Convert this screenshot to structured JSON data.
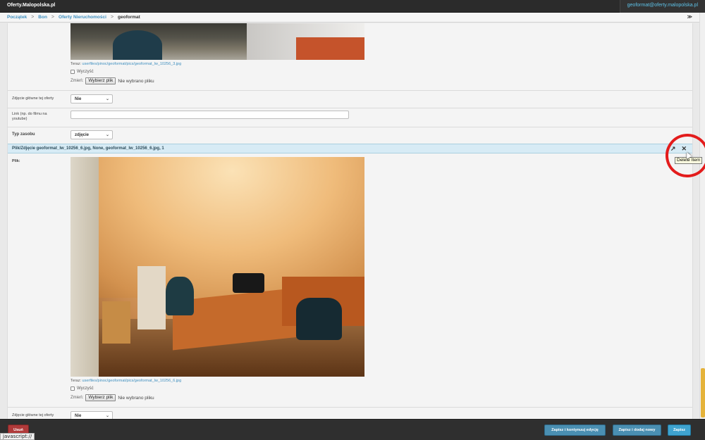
{
  "topbar": {
    "brand": "Oferty.Malopolska.pl",
    "user_email": "geoformat@oferty.malopolska.pl"
  },
  "breadcrumb": {
    "items": [
      "Początek",
      "Bon",
      "Oferty Nieruchomości"
    ],
    "current": "geoformat",
    "separator": ">",
    "toggle_icons": "≫"
  },
  "item1": {
    "current_label": "Teraz:",
    "current_file": "userfiles/pinoc/geoformat/pics/geoformat_lw_10256_3.jpg",
    "clear_label": "Wyczyść",
    "change_label": "Zmień:",
    "file_button": "Wybierz plik",
    "no_file": "Nie wybrano pliku",
    "main_photo_label": "Zdjęcie główne tej oferty",
    "main_photo_value": "Nie",
    "link_label": "Link (np. do filmu na youtube)",
    "link_value": "",
    "type_label": "Typ zasobu",
    "type_value": "zdjęcie"
  },
  "item2": {
    "header": "Plik/Zdjęcie  geoformat_lw_10256_6.jpg, None, geoformat_lw_10256_6.jpg, 1",
    "file_label": "Plik:",
    "current_label": "Teraz:",
    "current_file": "userfiles/pinoc/geoformat/pics/geoformat_lw_10256_6.jpg",
    "clear_label": "Wyczyść",
    "change_label": "Zmień:",
    "file_button": "Wybierz plik",
    "no_file": "Nie wybrano pliku",
    "main_photo_label": "Zdjęcie główne tej oferty",
    "main_photo_value": "Nie",
    "open_icon": "↗",
    "delete_icon": "✕"
  },
  "tooltip": "Delete Item",
  "footer": {
    "delete_button": "Usuń",
    "save_continue_button": "Zapisz i kontynuuj edycję",
    "save_add_button": "Zapisz i dodaj nowy",
    "save_button": "Zapisz"
  },
  "statusbar": "javascript://",
  "colors": {
    "accent": "#3f8fbf",
    "danger": "#b03a3a",
    "highlight": "#e31c1c",
    "scroll_thumb": "#e5b33a"
  }
}
